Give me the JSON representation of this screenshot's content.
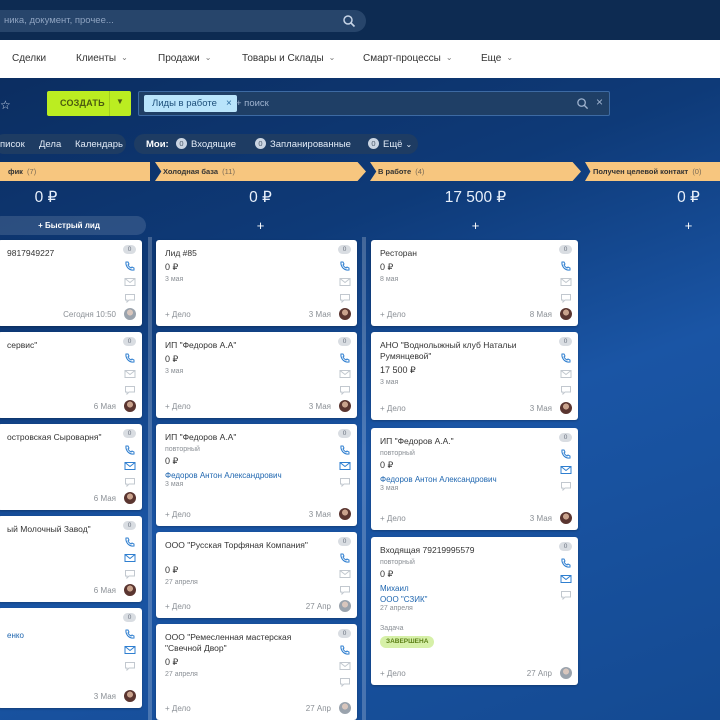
{
  "search": {
    "placeholder": "ника, документ, прочее..."
  },
  "menu": [
    {
      "label": "Сделки",
      "chevron": false
    },
    {
      "label": "Клиенты",
      "chevron": true
    },
    {
      "label": "Продажи",
      "chevron": true
    },
    {
      "label": "Товары и Склады",
      "chevron": true
    },
    {
      "label": "Смарт-процессы",
      "chevron": true
    },
    {
      "label": "Еще",
      "chevron": true
    }
  ],
  "toolbar": {
    "create_label": "СОЗДАТЬ",
    "filter_tag": "Лиды в работе",
    "filter_placeholder": "+ поиск"
  },
  "views": [
    "писок",
    "Дела",
    "Календарь"
  ],
  "counters": {
    "my_label": "Мои:",
    "items": [
      {
        "count": "0",
        "label": "Входящие"
      },
      {
        "count": "0",
        "label": "Запланированные"
      },
      {
        "count": "0",
        "label": "Ещё"
      }
    ]
  },
  "quick_lead": "+ Быстрый лид",
  "add_deal": "+ Дело",
  "columns": [
    {
      "title": "фик",
      "count": "(7)",
      "sum": "0 ₽",
      "cards": [
        {
          "title": "9817949227",
          "foot": "Сегодня 10:50",
          "num": "0",
          "avatar": "light"
        },
        {
          "title": "сервис\"",
          "foot": "6 Мая",
          "num": "0",
          "avatar": "dark"
        },
        {
          "title": "островская Сыроварня\"",
          "foot": "6 Мая",
          "num": "0",
          "avatar": "dark"
        },
        {
          "title": "ый Молочный Завод\"",
          "foot": "6 Мая",
          "num": "0",
          "avatar": "dark"
        },
        {
          "title": "",
          "contact": "енко",
          "foot": "3 Мая",
          "num": "0",
          "avatar": "dark"
        }
      ]
    },
    {
      "title": "Холодная база",
      "count": "(11)",
      "sum": "0 ₽",
      "cards": [
        {
          "title": "Лид #85",
          "price": "0 ₽",
          "date": "3 мая",
          "foot": "3 Мая",
          "num": "0",
          "avatar": "dark"
        },
        {
          "title": "ИП \"Федоров А.А\"",
          "price": "0 ₽",
          "date": "3 мая",
          "foot": "3 Мая",
          "num": "0",
          "avatar": "dark"
        },
        {
          "title": "ИП \"Федоров А.А\"",
          "sub": "повторный",
          "price": "0 ₽",
          "contact": "Федоров Антон Александрович",
          "date": "3 мая",
          "foot": "3 Мая",
          "num": "0",
          "avatar": "dark"
        },
        {
          "title": "ООО \"Русская Торфяная Компания\"",
          "price": "0 ₽",
          "date": "27 апреля",
          "foot": "27 Апр",
          "num": "0",
          "avatar": "light"
        },
        {
          "title": "ООО \"Ремесленная мастерская \"Свечной Двор\"",
          "price": "0 ₽",
          "date": "27 апреля",
          "foot": "27 Апр",
          "num": "0",
          "avatar": "light"
        }
      ]
    },
    {
      "title": "В работе",
      "count": "(4)",
      "sum": "17 500 ₽",
      "cards": [
        {
          "title": "Ресторан",
          "price": "0 ₽",
          "date": "8 мая",
          "foot": "8 Мая",
          "num": "0",
          "avatar": "dark"
        },
        {
          "title": "АНО \"Воднолыжный клуб Натальи Румянцевой\"",
          "price": "17 500 ₽",
          "date": "3 мая",
          "foot": "3 Мая",
          "num": "0",
          "avatar": "dark"
        },
        {
          "title": "ИП \"Федоров А.А.\"",
          "sub": "повторный",
          "price": "0 ₽",
          "contact": "Федоров Антон Александрович",
          "date": "3 мая",
          "foot": "3 Мая",
          "num": "0",
          "avatar": "dark"
        },
        {
          "title": "Входящая 79219995579",
          "sub": "повторный",
          "price": "0 ₽",
          "contact": "Михаил",
          "contact2": "ООО \"СЗИК\"",
          "date": "27 апреля",
          "task_label": "Задача",
          "task_badge": "ЗАВЕРШЕНА",
          "foot": "27 Апр",
          "num": "0",
          "avatar": "light"
        }
      ]
    },
    {
      "title": "Получен целевой контакт",
      "count": "(0)",
      "sum": "0 ₽",
      "cards": []
    }
  ],
  "colors": {
    "accent_green": "#bbed21",
    "column_head": "#f7c67f",
    "link": "#2067b0"
  }
}
